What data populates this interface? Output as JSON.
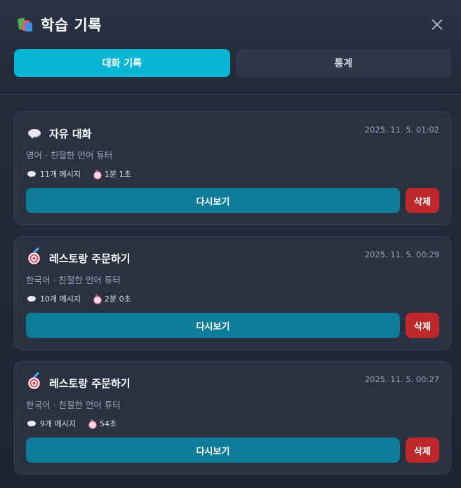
{
  "header": {
    "title": "학습 기록",
    "title_icon": "books-icon",
    "close_icon": "close-icon"
  },
  "tabs": [
    {
      "label": "대화 기록",
      "active": true
    },
    {
      "label": "통계",
      "active": false
    }
  ],
  "colors": {
    "accent": "#06b6d4",
    "review_button": "#0e7c99",
    "delete_button": "#c0292b"
  },
  "records": [
    {
      "icon": "speech-bubble-icon",
      "title": "자유 대화",
      "date": "2025. 11. 5. 01:02",
      "subtitle": "영어 · 친절한 언어 튜터",
      "messages": "11개 메시지",
      "duration": "1분 1초",
      "review_label": "다시보기",
      "delete_label": "삭제"
    },
    {
      "icon": "target-icon",
      "title": "레스토랑 주문하기",
      "date": "2025. 11. 5. 00:29",
      "subtitle": "한국어 · 친절한 언어 튜터",
      "messages": "10개 메시지",
      "duration": "2분 0초",
      "review_label": "다시보기",
      "delete_label": "삭제"
    },
    {
      "icon": "target-icon",
      "title": "레스토랑 주문하기",
      "date": "2025. 11. 5. 00:27",
      "subtitle": "한국어 · 친절한 언어 튜터",
      "messages": "9개 메시지",
      "duration": "54초",
      "review_label": "다시보기",
      "delete_label": "삭제"
    }
  ]
}
